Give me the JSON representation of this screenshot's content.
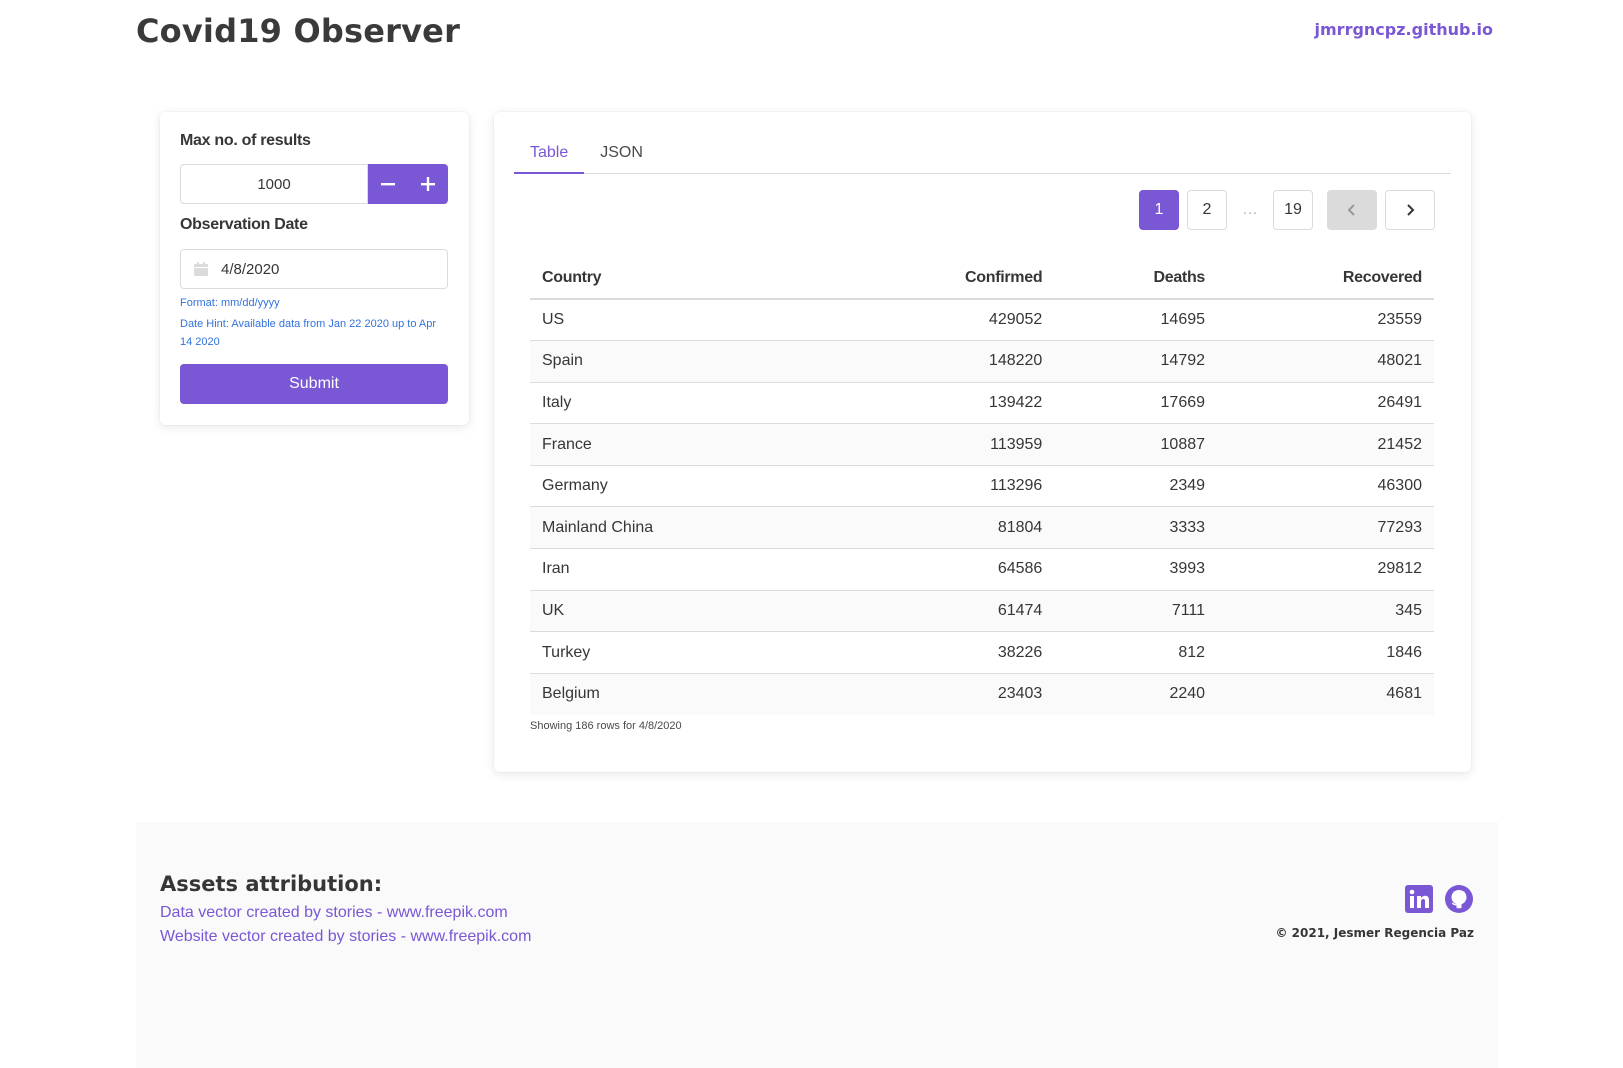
{
  "header": {
    "brand": "Covid19 Observer",
    "site_link": "jmrrgncpz.github.io"
  },
  "form": {
    "max_results_label": "Max no. of results",
    "max_results_value": "1000",
    "date_label": "Observation Date",
    "date_value": "4/8/2020",
    "format_help": "Format: mm/dd/yyyy",
    "date_hint": "Date Hint: Available data from Jan 22 2020 up to Apr 14 2020",
    "submit_label": "Submit"
  },
  "tabs": [
    {
      "label": "Table",
      "active": true
    },
    {
      "label": "JSON",
      "active": false
    }
  ],
  "pagination": {
    "current": "1",
    "page2": "2",
    "ellipsis": "…",
    "last": "19"
  },
  "table": {
    "columns": [
      "Country",
      "Confirmed",
      "Deaths",
      "Recovered"
    ],
    "rows": [
      [
        "US",
        "429052",
        "14695",
        "23559"
      ],
      [
        "Spain",
        "148220",
        "14792",
        "48021"
      ],
      [
        "Italy",
        "139422",
        "17669",
        "26491"
      ],
      [
        "France",
        "113959",
        "10887",
        "21452"
      ],
      [
        "Germany",
        "113296",
        "2349",
        "46300"
      ],
      [
        "Mainland China",
        "81804",
        "3333",
        "77293"
      ],
      [
        "Iran",
        "64586",
        "3993",
        "29812"
      ],
      [
        "UK",
        "61474",
        "7111",
        "345"
      ],
      [
        "Turkey",
        "38226",
        "812",
        "1846"
      ],
      [
        "Belgium",
        "23403",
        "2240",
        "4681"
      ]
    ],
    "summary": "Showing 186 rows for 4/8/2020"
  },
  "footer": {
    "title": "Assets attribution:",
    "link1": "Data vector created by stories - www.freepik.com",
    "link2": "Website vector created by stories - www.freepik.com",
    "copyright": "© 2021, Jesmer Regencia Paz"
  },
  "colors": {
    "accent": "#7957d5",
    "help_text": "#3273dc"
  }
}
